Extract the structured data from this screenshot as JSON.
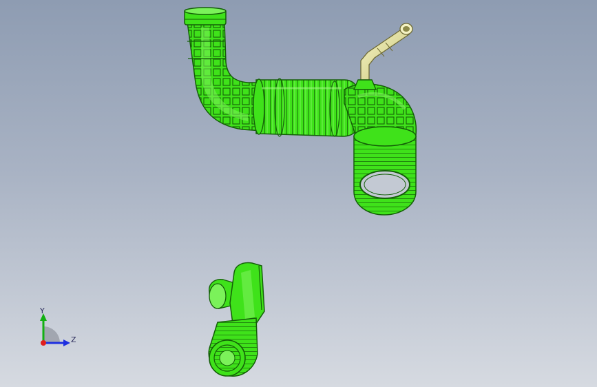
{
  "viewport": {
    "background_top": "#8e9cb2",
    "background_bottom": "#d6dae1"
  },
  "parts": {
    "hose_color": "#3fe21a",
    "hose_edge_color": "#145f08",
    "tube_color": "#e8e6a0",
    "tube_edge_color": "#6e6a35"
  },
  "triad": {
    "y_label": "Y",
    "z_label": "Z",
    "y_color": "#12b012",
    "z_color": "#1e2fe0",
    "x_color": "#e01e1e"
  }
}
